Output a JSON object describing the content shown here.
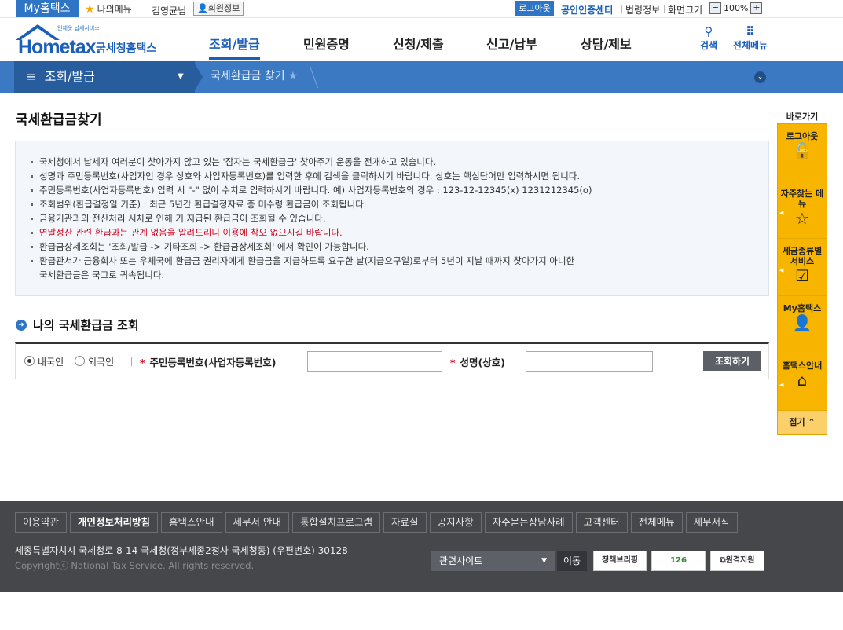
{
  "topbar": {
    "my_hometax": "My홈택스",
    "my_menu": "나의메뉴",
    "user_name": "김영균님",
    "member_info": "회원정보",
    "logout": "로그아웃",
    "cert_center": "공인인증센터",
    "law_info": "법령정보",
    "screen_size": "화면크기",
    "zoom_minus": "−",
    "zoom_level": "100%",
    "zoom_plus": "+"
  },
  "header": {
    "logo_text": "Hometax.",
    "logo_sub": "언제옷 납세서비스",
    "logo_kor": "국세청홈택스",
    "gnb": [
      "조회/발급",
      "민원증명",
      "신청/제출",
      "신고/납부",
      "상담/제보"
    ],
    "search_label": "검색",
    "allmenu_label": "전체메뉴"
  },
  "location": {
    "depth1": "조회/발급",
    "depth2": "국세환급금 찾기"
  },
  "main": {
    "page_title": "국세환급금찾기",
    "notices": [
      "국세청에서 납세자 여러분이 찾아가지 않고 있는 '잠자는 국세환급금' 찾아주기 운동을 전개하고 있습니다.",
      "성명과 주민등록번호(사업자인 경우 상호와 사업자등록번호)를 입력한 후에 검색을 클릭하시기 바랍니다. 상호는 핵심단어만 입력하시면 됩니다.",
      "주민등록번호(사업자등록번호) 입력 시 \"-\" 없이 수치로 입력하시기 바랍니다. 예) 사업자등록번호의 경우 : 123-12-12345(x) 1231212345(o)",
      "조회범위(환급결정일 기준) : 최근 5년간 환급결정자료 중 미수령 환급금이 조회됩니다.",
      "금융기관과의 전산처리 시차로 인해 기 지급된 환급금이 조회될 수 있습니다.",
      "연말정산 관련 환급과는 관계 없음을 알려드리니 이용에 착오 없으시길 바랍니다.",
      "환급금상세조회는 '조회/발급 -> 기타조회 -> 환급금상세조회' 에서 확인이 가능합니다.",
      "환급관서가 금융회사 또는 우체국에 환급금 권리자에게 환급금을 지급하도록 요구한 날(지급요구일)로부터 5년이 지날 때까지 찾아가지 아니한",
      "국세환급금은 국고로 귀속됩니다."
    ],
    "section_title": "나의 국세환급금 조회",
    "radio_domestic": "내국인",
    "radio_foreign": "외국인",
    "id_label": "주민등록번호(사업자등록번호)",
    "name_label": "성명(상호)",
    "id_value": "",
    "name_value": "",
    "submit_label": "조회하기"
  },
  "quick": {
    "title": "바로가기",
    "items": [
      "로그아웃",
      "자주찾는 메뉴",
      "세금종류별 서비스",
      "My홈택스",
      "홈택스안내"
    ],
    "fold": "접기"
  },
  "footer": {
    "links": [
      "이용약관",
      "개인정보처리방침",
      "홈택스안내",
      "세무서 안내",
      "통합설치프로그램",
      "자료실",
      "공지사항",
      "자주묻는상담사례",
      "고객센터",
      "전체메뉴",
      "세무서식"
    ],
    "address": "세종특별자치시 국세청로 8-14 국세청(정부세종2청사 국세청동) (우편번호) 30128",
    "copyright": "Copyrightⓒ National Tax Service. All rights reserved.",
    "related_site": "관련사이트",
    "move": "이동",
    "banner1": "정책브리핑",
    "banner2": "126",
    "banner3": "원격지원"
  }
}
